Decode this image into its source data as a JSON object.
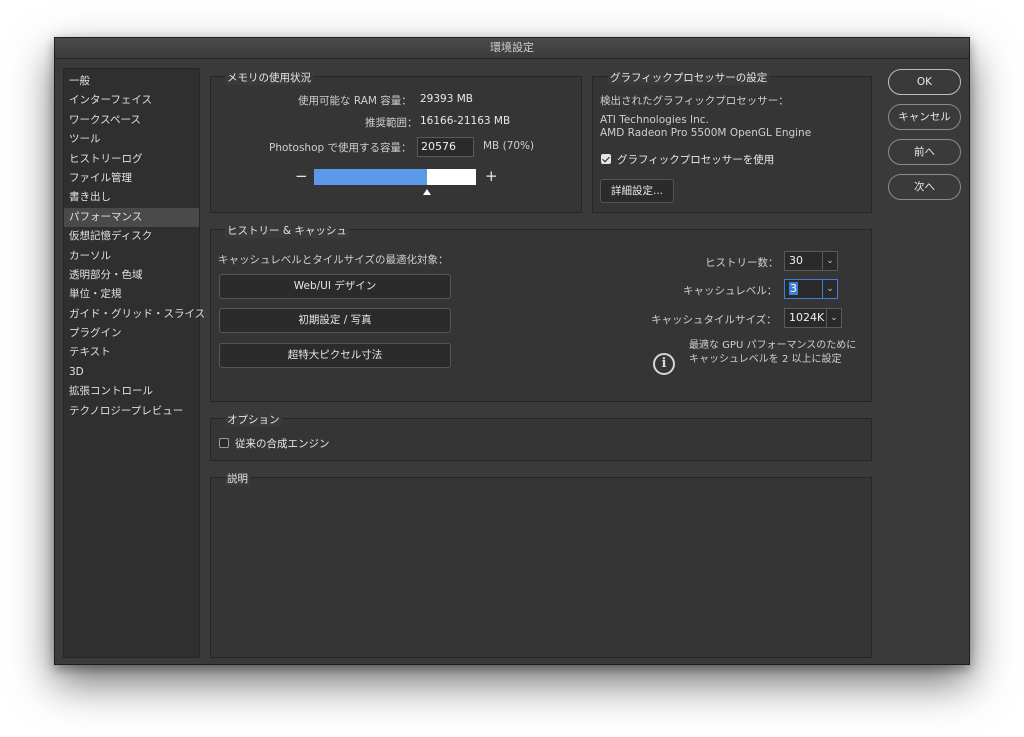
{
  "window": {
    "title": "環境設定"
  },
  "sidebar": {
    "items": [
      {
        "label": "一般"
      },
      {
        "label": "インターフェイス"
      },
      {
        "label": "ワークスペース"
      },
      {
        "label": "ツール"
      },
      {
        "label": "ヒストリーログ"
      },
      {
        "label": "ファイル管理"
      },
      {
        "label": "書き出し"
      },
      {
        "label": "パフォーマンス"
      },
      {
        "label": "仮想記憶ディスク"
      },
      {
        "label": "カーソル"
      },
      {
        "label": "透明部分・色域"
      },
      {
        "label": "単位・定規"
      },
      {
        "label": "ガイド・グリッド・スライス"
      },
      {
        "label": "プラグイン"
      },
      {
        "label": "テキスト"
      },
      {
        "label": "3D"
      },
      {
        "label": "拡張コントロール"
      },
      {
        "label": "テクノロジープレビュー"
      }
    ],
    "active_index": 7
  },
  "memory": {
    "title": "メモリの使用状況",
    "ram_label": "使用可能な RAM 容量：",
    "ram_value": "29393 MB",
    "range_label": "推奨範囲：",
    "range_value": "16166-21163 MB",
    "ps_label": "Photoshop で使用する容量：",
    "ps_value": "20576",
    "ps_unit": "MB (70%)",
    "minus": "−",
    "plus": "+",
    "slider_fraction": 0.7
  },
  "gpu": {
    "title": "グラフィックプロセッサーの設定",
    "detected_label": "検出されたグラフィックプロセッサー：",
    "vendor": "ATI Technologies Inc.",
    "model": "AMD Radeon Pro 5500M OpenGL Engine",
    "use_gpu_label": "グラフィックプロセッサーを使用",
    "use_gpu_checked": true,
    "advanced_button": "詳細設定..."
  },
  "history_cache": {
    "title": "ヒストリー & キャッシュ",
    "optimize_label": "キャッシュレベルとタイルサイズの最適化対象：",
    "buttons": [
      "Web/UI デザイン",
      "初期設定 / 写真",
      "超特大ピクセル寸法"
    ],
    "history_states_label": "ヒストリー数：",
    "history_states_value": "30",
    "cache_levels_label": "キャッシュレベル：",
    "cache_levels_value": "3",
    "cache_tile_label": "キャッシュタイルサイズ：",
    "cache_tile_value": "1024K",
    "info_line1": "最適な GPU パフォーマンスのために",
    "info_line2": "キャッシュレベルを 2 以上に設定"
  },
  "options": {
    "title": "オプション",
    "legacy_compositing_label": "従来の合成エンジン",
    "legacy_compositing_checked": false
  },
  "description": {
    "title": "説明"
  },
  "dialog_buttons": {
    "ok": "OK",
    "cancel": "キャンセル",
    "prev": "前へ",
    "next": "次へ"
  },
  "icons": {
    "info": "info-circle-icon",
    "chevron": "chevron-down-icon"
  }
}
